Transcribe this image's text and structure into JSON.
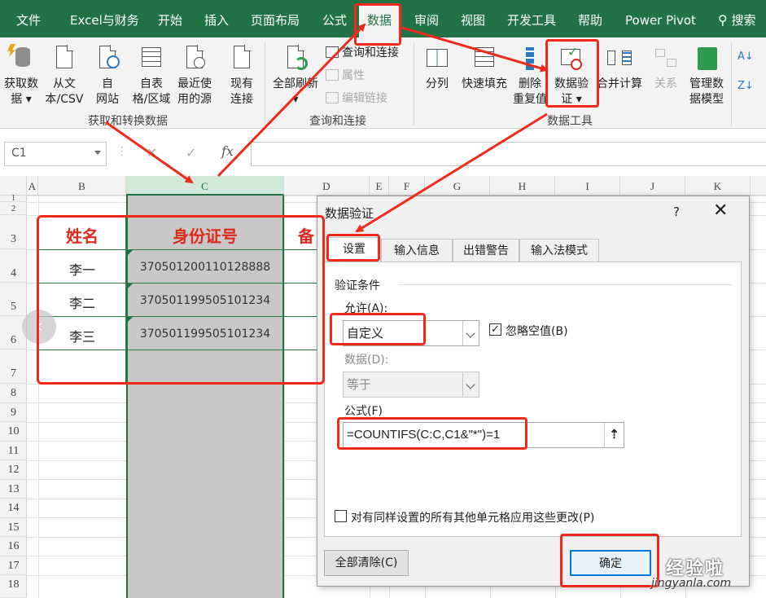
{
  "menu": {
    "tabs": [
      "文件",
      "Excel与财务",
      "开始",
      "插入",
      "页面布局",
      "公式",
      "数据",
      "审阅",
      "视图",
      "开发工具",
      "帮助",
      "Power Pivot"
    ],
    "search": "搜索",
    "active_tab": "数据"
  },
  "ribbon": {
    "get_data": {
      "line1": "获取数",
      "line2": "据 ▾"
    },
    "from_csv": {
      "line1": "从文",
      "line2": "本/CSV"
    },
    "from_web": {
      "line1": "自",
      "line2": "网站"
    },
    "from_table": {
      "line1": "自表",
      "line2": "格/区域"
    },
    "recent": {
      "line1": "最近使",
      "line2": "用的源"
    },
    "existing": {
      "line1": "现有",
      "line2": "连接"
    },
    "group1_label": "获取和转换数据",
    "refresh_all": {
      "line1": "全部刷新",
      "line2": "▾"
    },
    "queries": "查询和连接",
    "properties": "属性",
    "edit_links": "编辑链接",
    "group2_label": "查询和连接",
    "split": "分列",
    "flash_fill": "快速填充",
    "remove_dup": {
      "line1": "删除",
      "line2": "重复值"
    },
    "data_validation": {
      "line1": "数据验",
      "line2": "证 ▾"
    },
    "consolidate": "合并计算",
    "relations": "关系",
    "manage_model": {
      "line1": "管理数",
      "line2": "据模型"
    },
    "group3_label": "数据工具"
  },
  "formula_bar": {
    "name_box": "C1",
    "fx": "fx",
    "cancel": "✕",
    "confirm": "✓"
  },
  "columns": [
    "A",
    "B",
    "C",
    "D",
    "E",
    "F",
    "G",
    "H",
    "I",
    "J",
    "K"
  ],
  "rows": [
    "1",
    "2",
    "3",
    "4",
    "5",
    "6",
    "7",
    "8",
    "9",
    "10",
    "11",
    "12",
    "13",
    "14",
    "15",
    "16",
    "17",
    "18"
  ],
  "table": {
    "headers": [
      "姓名",
      "身份证号",
      "备"
    ],
    "rows": [
      {
        "name": "李一",
        "id": "370501200110128888"
      },
      {
        "name": "李二",
        "id": "370501199505101234"
      },
      {
        "name": "李三",
        "id": "370501199505101234"
      }
    ]
  },
  "dialog": {
    "title": "数据验证",
    "help": "?",
    "close": "✕",
    "tabs": [
      "设置",
      "输入信息",
      "出错警告",
      "输入法模式"
    ],
    "section": "验证条件",
    "allow_label": "允许(A):",
    "allow_value": "自定义",
    "ignore_blank": "忽略空值(B)",
    "ignore_blank_checked": true,
    "data_label": "数据(D):",
    "data_value": "等于",
    "formula_label": "公式(F)",
    "formula_value": "=COUNTIFS(C:C,C1&\"*\")=1",
    "apply_all": "对有同样设置的所有其他单元格应用这些更改(P)",
    "clear_all": "全部清除(C)",
    "ok": "确定"
  },
  "watermark": {
    "cn": "经验啦",
    "url": "jingyanla.com"
  },
  "colors": {
    "excel_green": "#217346",
    "annotation_red": "#f02a1a",
    "header_red": "#e0281c"
  }
}
